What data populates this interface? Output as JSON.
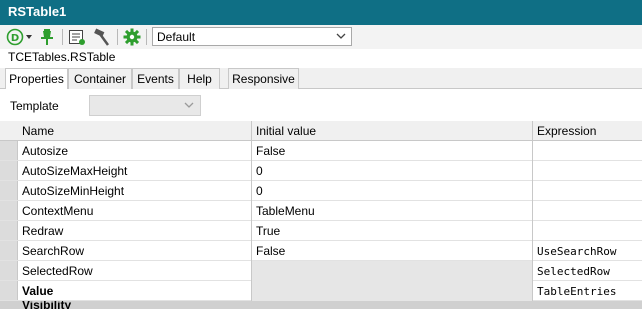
{
  "window": {
    "title": "RSTable1"
  },
  "toolbar": {
    "preset": "Default",
    "icons": [
      "d-menu-icon",
      "pin-icon",
      "list-icon",
      "hammer-icon",
      "gear-icon"
    ],
    "accent_color": "#2e9e2e"
  },
  "class_name": "TCETables.RSTable",
  "tabs": [
    {
      "label": "Properties",
      "active": true
    },
    {
      "label": "Container",
      "active": false
    },
    {
      "label": "Events",
      "active": false
    },
    {
      "label": "Help",
      "active": false
    },
    {
      "label": "Responsive",
      "active": false
    }
  ],
  "template": {
    "label": "Template",
    "value": ""
  },
  "grid": {
    "columns": [
      "Name",
      "Initial value",
      "Expression"
    ],
    "rows": [
      {
        "name": "Autosize",
        "initial": "False",
        "expression": ""
      },
      {
        "name": "AutoSizeMaxHeight",
        "initial": "0",
        "expression": ""
      },
      {
        "name": "AutoSizeMinHeight",
        "initial": "0",
        "expression": ""
      },
      {
        "name": "ContextMenu",
        "initial": "TableMenu",
        "expression": ""
      },
      {
        "name": "Redraw",
        "initial": "True",
        "expression": ""
      },
      {
        "name": "SearchRow",
        "initial": "False",
        "expression": "UseSearchRow"
      },
      {
        "name": "SelectedRow",
        "initial": "",
        "expression": "SelectedRow"
      },
      {
        "name": "Value",
        "initial": "",
        "expression": "TableEntries"
      }
    ],
    "section": "Visibility"
  }
}
